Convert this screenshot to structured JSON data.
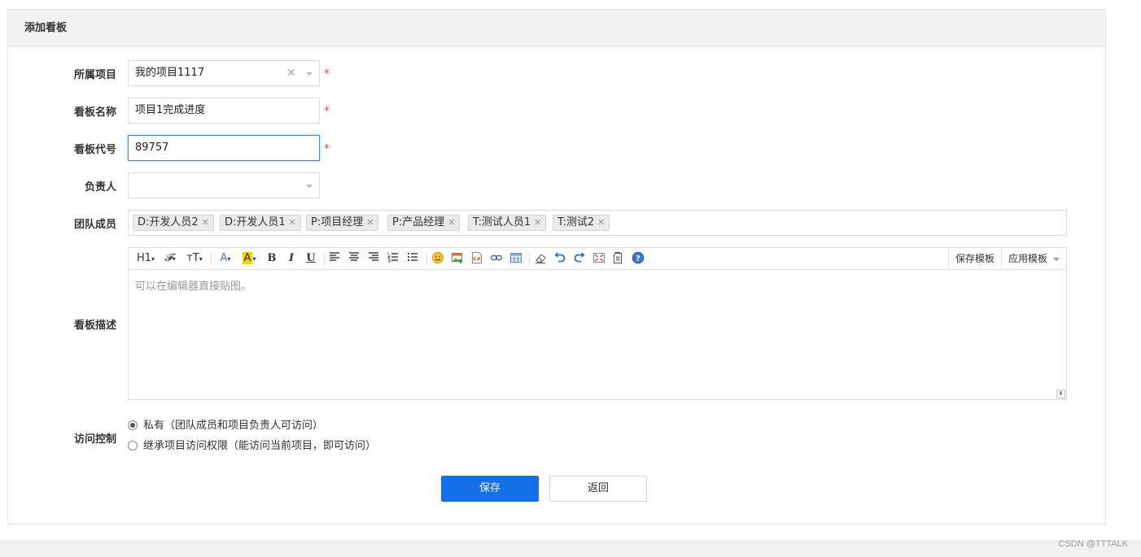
{
  "panel": {
    "title": "添加看板"
  },
  "form": {
    "project": {
      "label": "所属项目",
      "value": "我的项目1117",
      "required_mark": "*"
    },
    "board_name": {
      "label": "看板名称",
      "value": "项目1完成进度",
      "required_mark": "*"
    },
    "board_code": {
      "label": "看板代号",
      "value": "89757",
      "required_mark": "*"
    },
    "owner": {
      "label": "负责人",
      "value": ""
    },
    "team_members": {
      "label": "团队成员",
      "tags": [
        "D:开发人员2",
        "D:开发人员1",
        "P:项目经理",
        "P:产品经理",
        "T:测试人员1",
        "T:测试2"
      ]
    },
    "description": {
      "label": "看板描述",
      "placeholder": "可以在编辑器直接贴图。",
      "toolbar": {
        "heading": "H1",
        "font_family": "𝓕",
        "font_size": "тT",
        "font_color": "A",
        "bg_color": "A",
        "bold": "B",
        "italic": "I",
        "underline": "U",
        "save_template": "保存模板",
        "apply_template": "应用模板"
      }
    },
    "access_control": {
      "label": "访问控制",
      "options": [
        {
          "text": "私有（团队成员和项目负责人可访问）",
          "checked": true
        },
        {
          "text": "继承项目访问权限（能访问当前项目，即可访问）",
          "checked": false
        }
      ]
    }
  },
  "actions": {
    "save": "保存",
    "back": "返回"
  },
  "watermark": "CSDN @TTTALK",
  "colors": {
    "primary": "#1470e8",
    "required": "#e74c3c",
    "focus_border": "#3b8ef0",
    "header_bg": "#f1f1f1"
  }
}
